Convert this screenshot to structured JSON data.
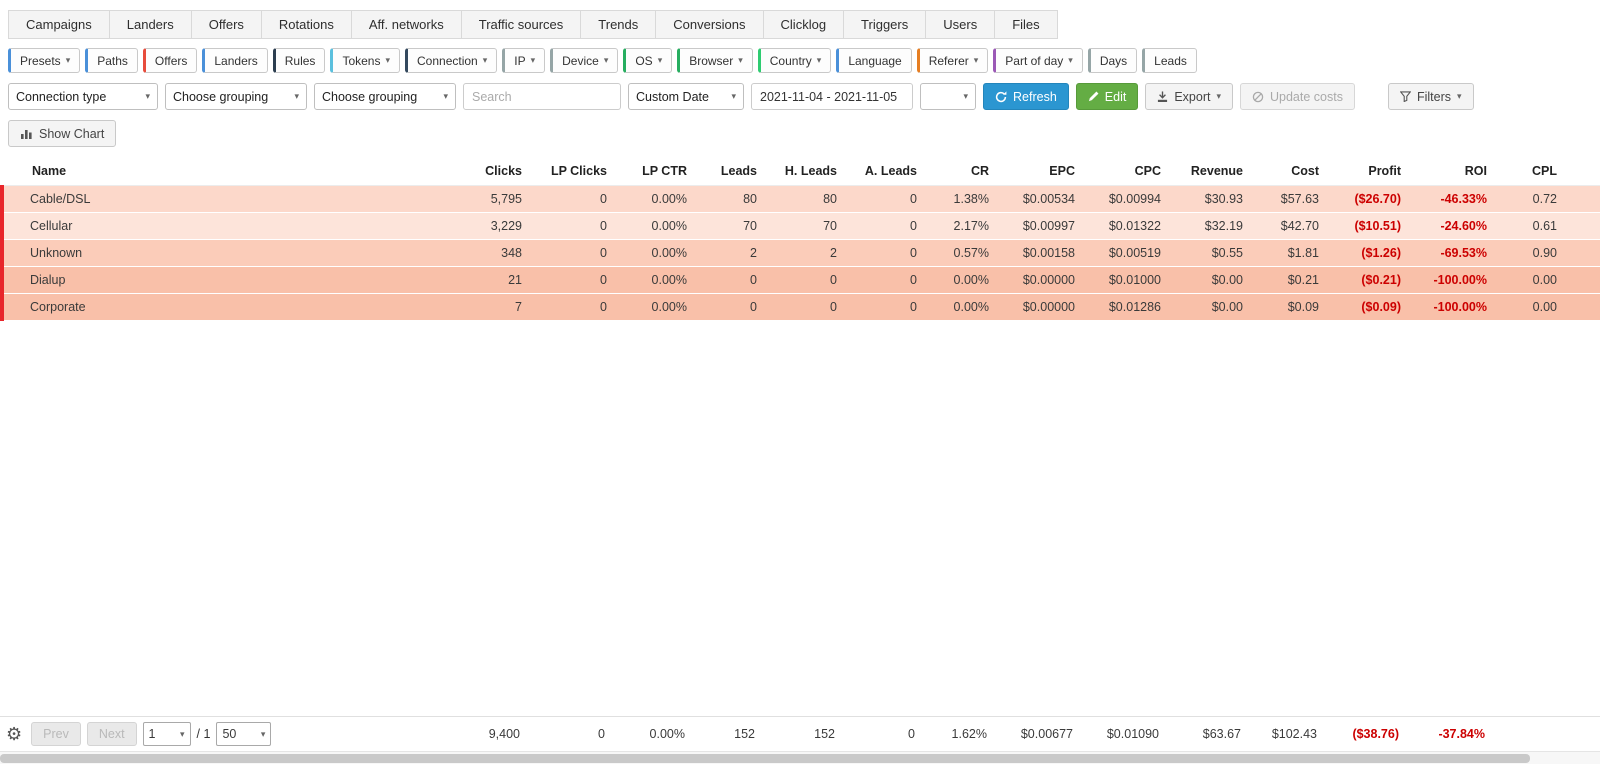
{
  "nav_tabs": [
    "Campaigns",
    "Landers",
    "Offers",
    "Rotations",
    "Aff. networks",
    "Traffic sources",
    "Trends",
    "Conversions",
    "Clicklog",
    "Triggers",
    "Users",
    "Files"
  ],
  "filter_buttons": [
    {
      "label": "Presets",
      "caret": true,
      "accent": "#4a90d9"
    },
    {
      "label": "Paths",
      "caret": false,
      "accent": "#4a90d9"
    },
    {
      "label": "Offers",
      "caret": false,
      "accent": "#e74c3c"
    },
    {
      "label": "Landers",
      "caret": false,
      "accent": "#4a90d9"
    },
    {
      "label": "Rules",
      "caret": false,
      "accent": "#2c3e50"
    },
    {
      "label": "Tokens",
      "caret": true,
      "accent": "#5bc0de"
    },
    {
      "label": "Connection",
      "caret": true,
      "accent": "#34495e"
    },
    {
      "label": "IP",
      "caret": true,
      "accent": "#95a5a6"
    },
    {
      "label": "Device",
      "caret": true,
      "accent": "#95a5a6"
    },
    {
      "label": "OS",
      "caret": true,
      "accent": "#27ae60"
    },
    {
      "label": "Browser",
      "caret": true,
      "accent": "#27ae60"
    },
    {
      "label": "Country",
      "caret": true,
      "accent": "#2ecc71"
    },
    {
      "label": "Language",
      "caret": false,
      "accent": "#4a90d9"
    },
    {
      "label": "Referer",
      "caret": true,
      "accent": "#e67e22"
    },
    {
      "label": "Part of day",
      "caret": true,
      "accent": "#9b59b6"
    },
    {
      "label": "Days",
      "caret": false,
      "accent": "#95a5a6"
    },
    {
      "label": "Leads",
      "caret": false,
      "accent": "#95a5a6"
    }
  ],
  "toolbar": {
    "connection_type_select": "Connection type",
    "grouping_select_1": "Choose grouping",
    "grouping_select_2": "Choose grouping",
    "search_placeholder": "Search",
    "date_mode_select": "Custom Date",
    "date_range_value": "2021-11-04 - 2021-11-05",
    "timezone_select_value": "",
    "refresh_label": "Refresh",
    "edit_label": "Edit",
    "export_label": "Export",
    "update_costs_label": "Update costs",
    "filters_label": "Filters",
    "show_chart_label": "Show Chart"
  },
  "table": {
    "columns": [
      "Name",
      "Clicks",
      "LP Clicks",
      "LP CTR",
      "Leads",
      "H. Leads",
      "A. Leads",
      "CR",
      "EPC",
      "CPC",
      "Revenue",
      "Cost",
      "Profit",
      "ROI",
      "CPL"
    ],
    "rows": [
      {
        "cells": [
          "Cable/DSL",
          "5,795",
          "0",
          "0.00%",
          "80",
          "80",
          "0",
          "1.38%",
          "$0.00534",
          "$0.00994",
          "$30.93",
          "$57.63",
          "($26.70)",
          "-46.33%",
          "0.72"
        ],
        "bg": "#fcd8ca"
      },
      {
        "cells": [
          "Cellular",
          "3,229",
          "0",
          "0.00%",
          "70",
          "70",
          "0",
          "2.17%",
          "$0.00997",
          "$0.01322",
          "$32.19",
          "$42.70",
          "($10.51)",
          "-24.60%",
          "0.61"
        ],
        "bg": "#fde4da"
      },
      {
        "cells": [
          "Unknown",
          "348",
          "0",
          "0.00%",
          "2",
          "2",
          "0",
          "0.57%",
          "$0.00158",
          "$0.00519",
          "$0.55",
          "$1.81",
          "($1.26)",
          "-69.53%",
          "0.90"
        ],
        "bg": "#fbccb9"
      },
      {
        "cells": [
          "Dialup",
          "21",
          "0",
          "0.00%",
          "0",
          "0",
          "0",
          "0.00%",
          "$0.00000",
          "$0.01000",
          "$0.00",
          "$0.21",
          "($0.21)",
          "-100.00%",
          "0.00"
        ],
        "bg": "#f9c0a9"
      },
      {
        "cells": [
          "Corporate",
          "7",
          "0",
          "0.00%",
          "0",
          "0",
          "0",
          "0.00%",
          "$0.00000",
          "$0.01286",
          "$0.00",
          "$0.09",
          "($0.09)",
          "-100.00%",
          "0.00"
        ],
        "bg": "#f9c0a9"
      }
    ],
    "totals": [
      "",
      "9,400",
      "0",
      "0.00%",
      "152",
      "152",
      "0",
      "1.62%",
      "$0.00677",
      "$0.01090",
      "$63.67",
      "$102.43",
      "($38.76)",
      "-37.84%",
      ""
    ],
    "negative_color": "#cc0000",
    "row_accent_color": "#e8252a"
  },
  "pagination": {
    "prev_label": "Prev",
    "next_label": "Next",
    "page_value": "1",
    "page_total": "/ 1",
    "per_page_value": "50"
  },
  "icons": {
    "caret_down": "▾",
    "gear": "⚙",
    "show_chart": "bar-chart-svg",
    "refresh": "circular-arrow-svg",
    "edit": "pencil-svg",
    "export": "download-svg",
    "update_costs": "slashed-circle-svg",
    "filters": "funnel-svg"
  }
}
